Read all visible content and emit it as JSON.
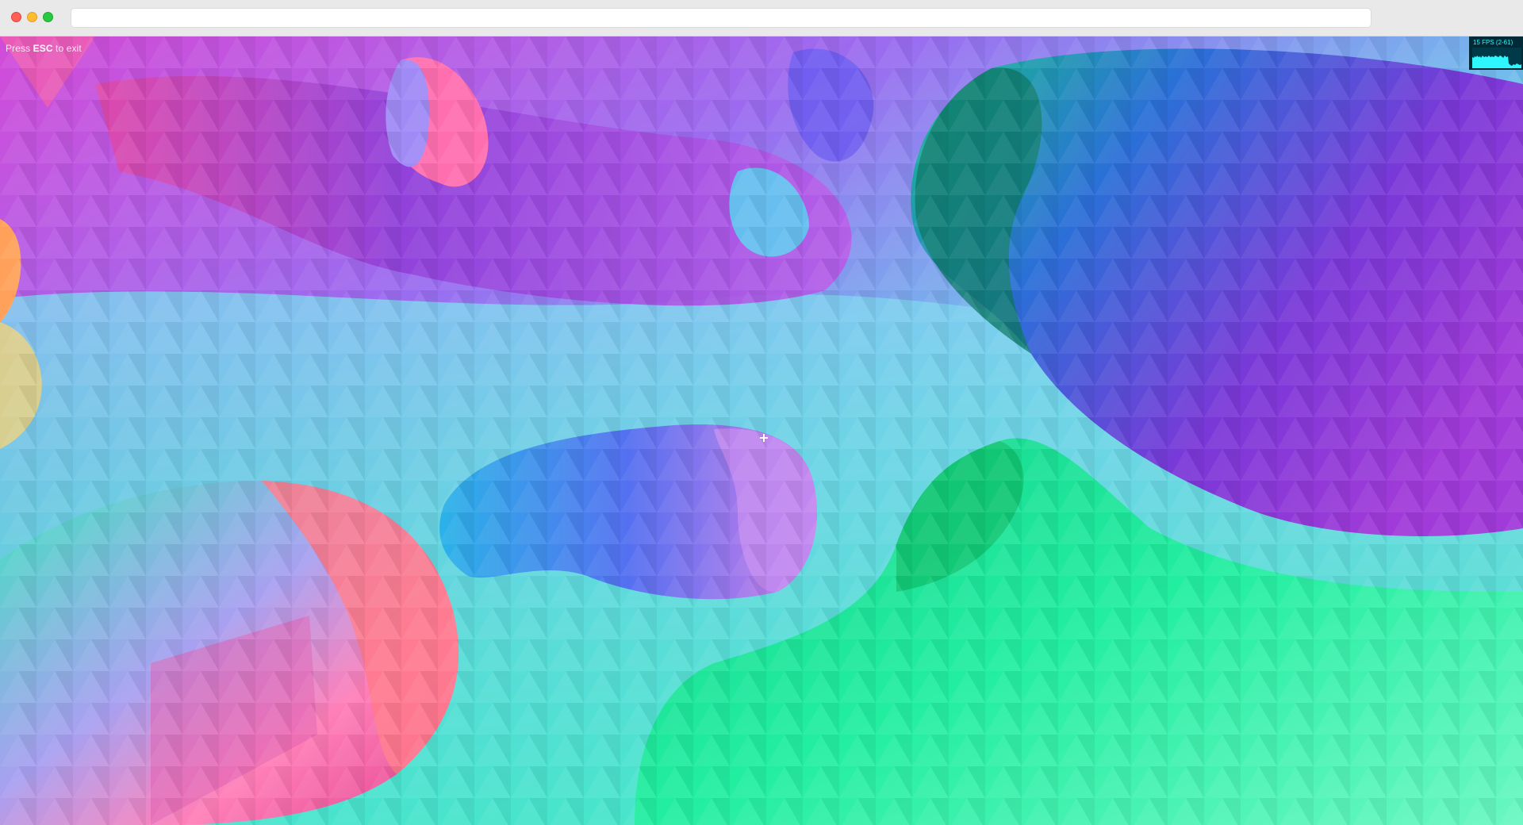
{
  "window": {
    "title": "",
    "address": ""
  },
  "hint": {
    "prefix": "Press",
    "key": "ESC",
    "suffix": "to exit"
  },
  "stats": {
    "fps_label": "15 FPS (2-61)",
    "fps_current": 15,
    "fps_min": 2,
    "fps_max": 61,
    "text_color": "#2ff7ff",
    "bg_color": "#002b36"
  },
  "scene": {
    "description_colors": [
      "#ff4fa0",
      "#9b5cf6",
      "#3ba7f0",
      "#27e3b0",
      "#20e87a",
      "#ffb347"
    ]
  }
}
